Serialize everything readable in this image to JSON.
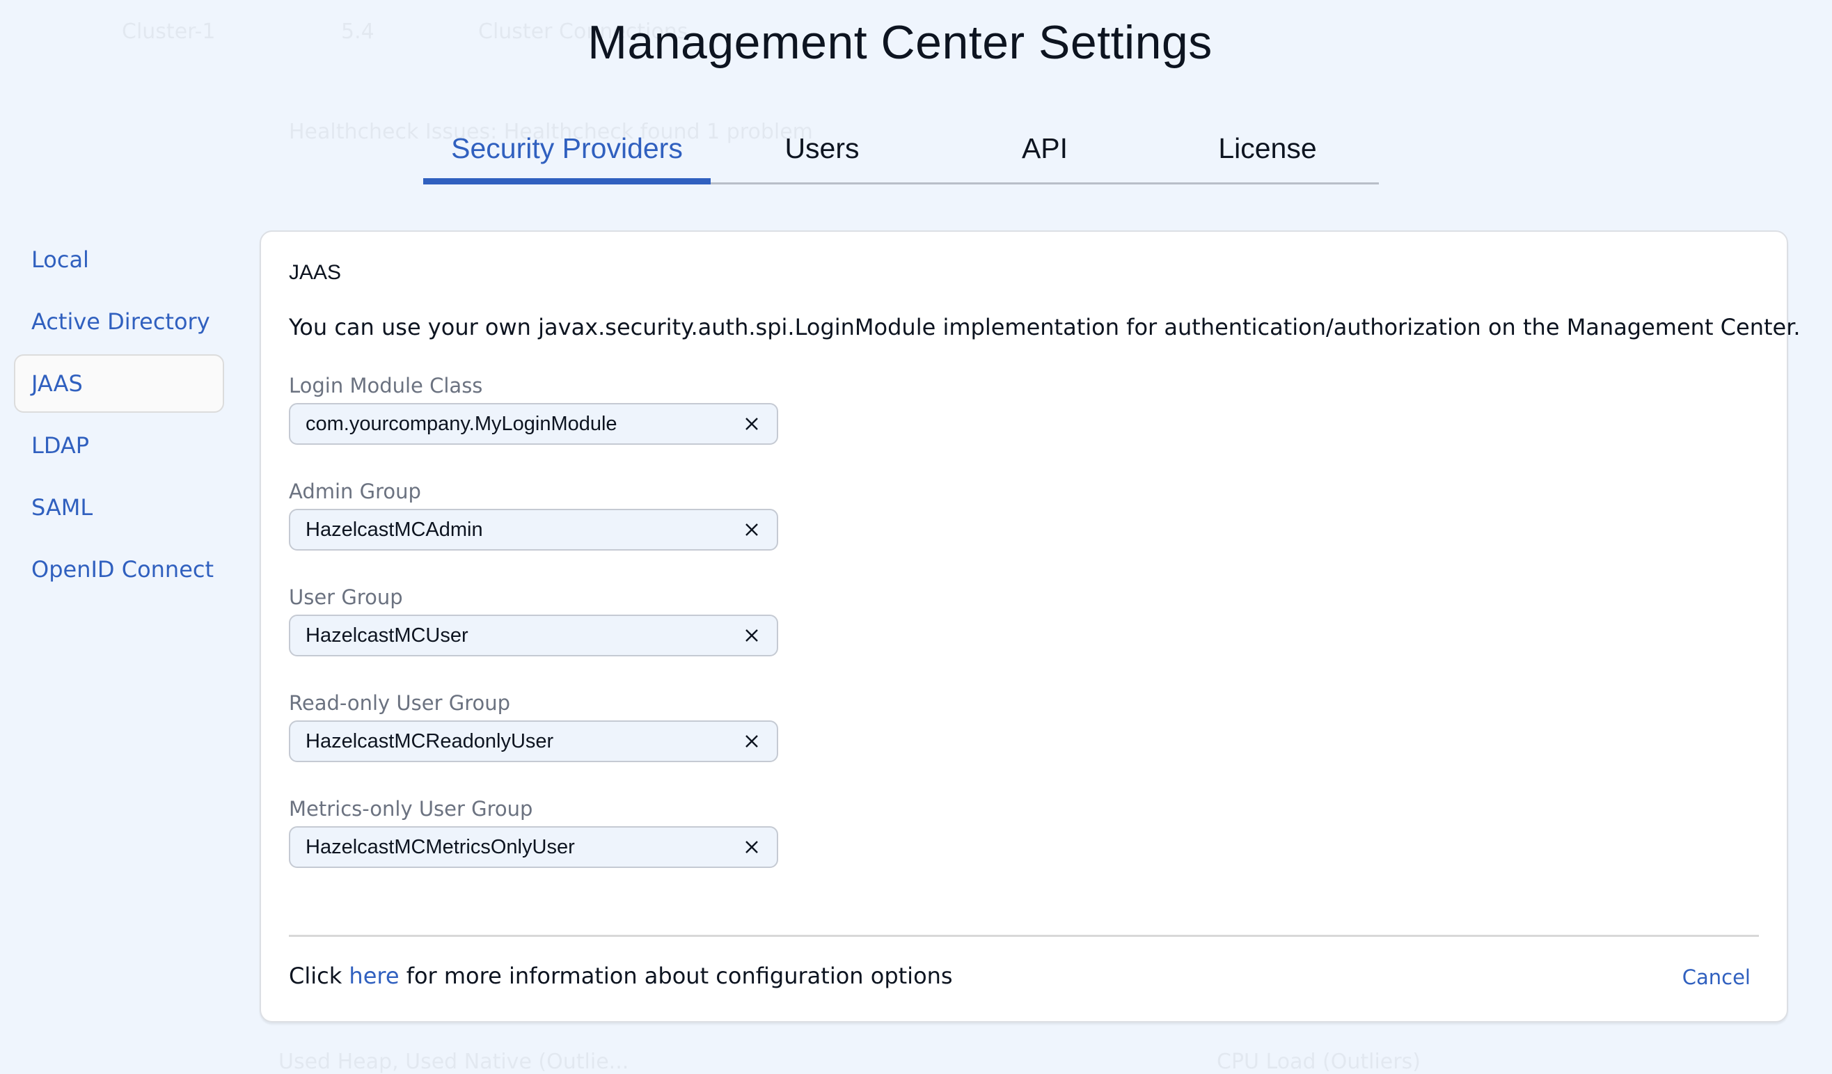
{
  "background": {
    "cluster_name": "Cluster-1",
    "version": "5.4",
    "cluster_connections": "Cluster Connections",
    "healthcheck": "Healthcheck Issues: Healthcheck found 1 problem",
    "chart_left": "Used Heap, Used Native (Outlie...",
    "chart_right": "CPU Load (Outliers)"
  },
  "dialog": {
    "title": "Management Center Settings",
    "tabs": [
      {
        "label": "Security Providers",
        "active": true
      },
      {
        "label": "Users",
        "active": false
      },
      {
        "label": "API",
        "active": false
      },
      {
        "label": "License",
        "active": false
      }
    ]
  },
  "sidebar": {
    "items": [
      {
        "label": "Local"
      },
      {
        "label": "Active Directory"
      },
      {
        "label": "JAAS",
        "selected": true
      },
      {
        "label": "LDAP"
      },
      {
        "label": "SAML"
      },
      {
        "label": "OpenID Connect"
      }
    ]
  },
  "panel": {
    "heading": "JAAS",
    "description": "You can use your own javax.security.auth.spi.LoginModule implementation for authentication/authorization on the Management Center.",
    "fields": [
      {
        "label": "Login Module Class",
        "value": "com.yourcompany.MyLoginModule"
      },
      {
        "label": "Admin Group",
        "value": "HazelcastMCAdmin"
      },
      {
        "label": "User Group",
        "value": "HazelcastMCUser"
      },
      {
        "label": "Read-only User Group",
        "value": "HazelcastMCReadonlyUser"
      },
      {
        "label": "Metrics-only User Group",
        "value": "HazelcastMCMetricsOnlyUser"
      }
    ],
    "footer": {
      "prefix": "Click",
      "link": "here",
      "suffix": "for more information about configuration options"
    },
    "cancel_label": "Cancel"
  },
  "colors": {
    "accent": "#3060bf",
    "background": "#eff5fd",
    "input_bg": "#eef4fc"
  }
}
